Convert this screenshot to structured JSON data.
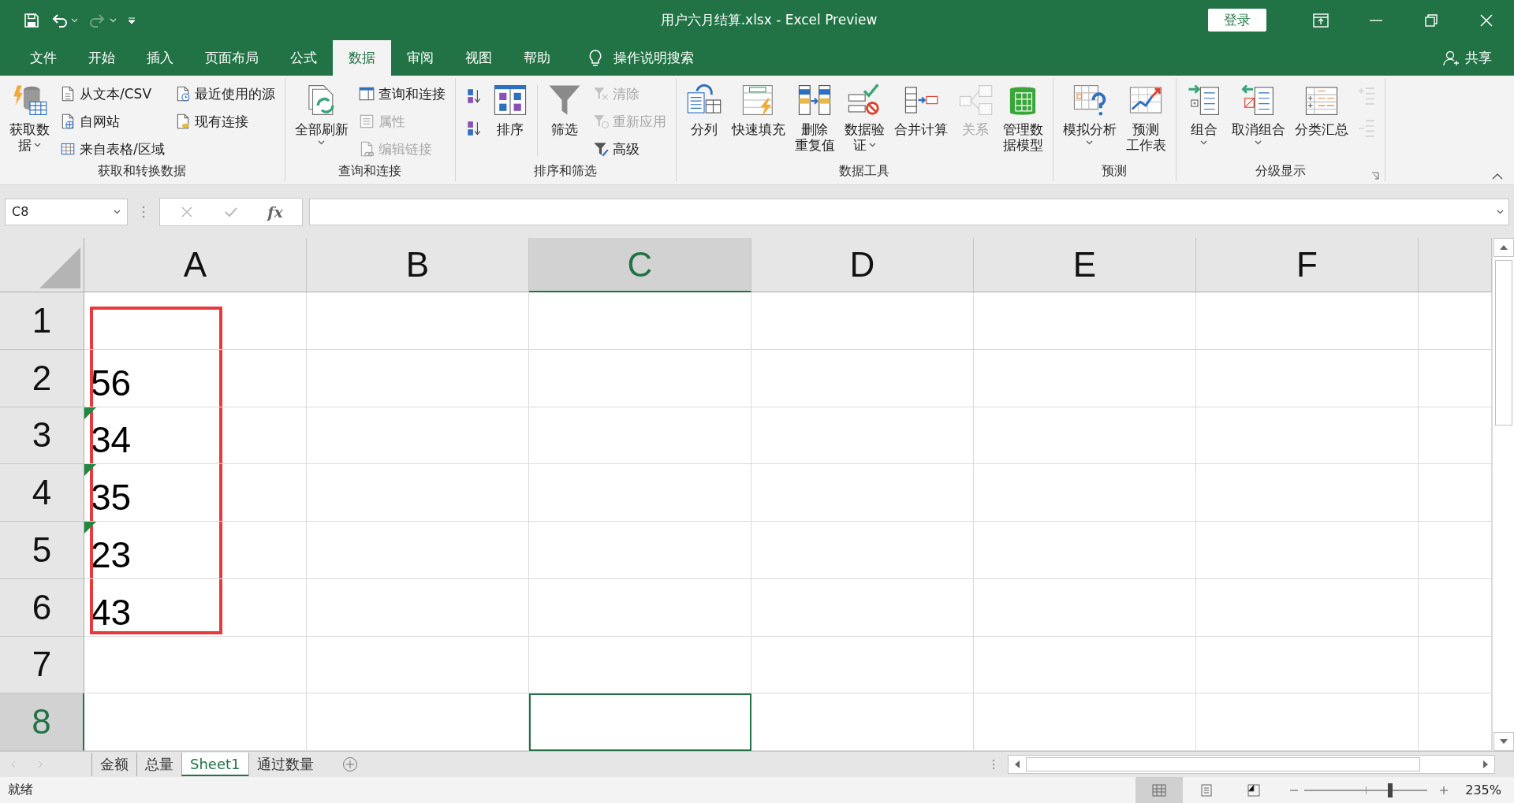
{
  "window": {
    "title": "用户六月结算.xlsx  -  Excel Preview",
    "sign_in": "登录"
  },
  "quick_access": {
    "redo_disabled": true
  },
  "tabs": [
    {
      "label": "文件",
      "selected": false
    },
    {
      "label": "开始",
      "selected": false
    },
    {
      "label": "插入",
      "selected": false
    },
    {
      "label": "页面布局",
      "selected": false
    },
    {
      "label": "公式",
      "selected": false
    },
    {
      "label": "数据",
      "selected": true
    },
    {
      "label": "审阅",
      "selected": false
    },
    {
      "label": "视图",
      "selected": false
    },
    {
      "label": "帮助",
      "selected": false
    }
  ],
  "tell_me": "操作说明搜索",
  "share": "共享",
  "ribbon_groups": [
    {
      "label": "获取和转换数据",
      "items": [
        {
          "kind": "large",
          "lines": [
            "获取数",
            "据"
          ],
          "dropdown": true,
          "disabled": false
        },
        {
          "kind": "stack",
          "entries": [
            {
              "label": "从文本/CSV",
              "disabled": false
            },
            {
              "label": "自网站",
              "disabled": false
            },
            {
              "label": "来自表格/区域",
              "disabled": false
            }
          ]
        },
        {
          "kind": "stack",
          "entries": [
            {
              "label": "最近使用的源",
              "disabled": false
            },
            {
              "label": "现有连接",
              "disabled": false
            }
          ]
        }
      ]
    },
    {
      "label": "查询和连接",
      "items": [
        {
          "kind": "large",
          "lines": [
            "全部刷新"
          ],
          "dropdown": true,
          "disabled": false
        },
        {
          "kind": "stack",
          "entries": [
            {
              "label": "查询和连接",
              "disabled": false
            },
            {
              "label": "属性",
              "disabled": true
            },
            {
              "label": "编辑链接",
              "disabled": true
            }
          ]
        }
      ]
    },
    {
      "label": "排序和筛选",
      "items": [
        {
          "kind": "icons",
          "entries": [
            {
              "disabled": false
            },
            {
              "disabled": false
            }
          ]
        },
        {
          "kind": "large",
          "lines": [
            "排序"
          ],
          "dropdown": false,
          "disabled": false
        },
        {
          "kind": "separator"
        },
        {
          "kind": "large",
          "lines": [
            "筛选"
          ],
          "dropdown": false,
          "disabled": false
        },
        {
          "kind": "stack",
          "entries": [
            {
              "label": "清除",
              "disabled": true
            },
            {
              "label": "重新应用",
              "disabled": true
            },
            {
              "label": "高级",
              "disabled": false
            }
          ]
        }
      ]
    },
    {
      "label": "数据工具",
      "items": [
        {
          "kind": "large",
          "lines": [
            "分列"
          ],
          "dropdown": false,
          "disabled": false
        },
        {
          "kind": "large",
          "lines": [
            "快速填充"
          ],
          "dropdown": false,
          "disabled": false
        },
        {
          "kind": "large",
          "lines": [
            "删除",
            "重复值"
          ],
          "dropdown": false,
          "disabled": false
        },
        {
          "kind": "large",
          "lines": [
            "数据验",
            "证"
          ],
          "dropdown": true,
          "disabled": false
        },
        {
          "kind": "large",
          "lines": [
            "合并计算"
          ],
          "dropdown": false,
          "disabled": false
        },
        {
          "kind": "large",
          "lines": [
            "关系"
          ],
          "dropdown": false,
          "disabled": true
        },
        {
          "kind": "large",
          "lines": [
            "管理数",
            "据模型"
          ],
          "dropdown": false,
          "disabled": false
        }
      ]
    },
    {
      "label": "预测",
      "items": [
        {
          "kind": "large",
          "lines": [
            "模拟分析"
          ],
          "dropdown": true,
          "disabled": false
        },
        {
          "kind": "large",
          "lines": [
            "预测",
            "工作表"
          ],
          "dropdown": false,
          "disabled": false
        }
      ]
    },
    {
      "label": "分级显示",
      "launcher": true,
      "items": [
        {
          "kind": "large",
          "lines": [
            "组合"
          ],
          "dropdown": true,
          "disabled": false
        },
        {
          "kind": "large",
          "lines": [
            "取消组合"
          ],
          "dropdown": true,
          "disabled": false
        },
        {
          "kind": "large",
          "lines": [
            "分类汇总"
          ],
          "dropdown": false,
          "disabled": false
        },
        {
          "kind": "icons",
          "entries": [
            {
              "disabled": true
            },
            {
              "disabled": true
            }
          ]
        }
      ]
    }
  ],
  "formula_bar": {
    "name_box": "C8",
    "function_label": "fx"
  },
  "grid": {
    "columns": [
      {
        "label": "A",
        "selected": false
      },
      {
        "label": "B",
        "selected": false
      },
      {
        "label": "C",
        "selected": true
      },
      {
        "label": "D",
        "selected": false
      },
      {
        "label": "E",
        "selected": false
      },
      {
        "label": "F",
        "selected": false
      }
    ],
    "rows": [
      {
        "label": "1",
        "selected": false,
        "outlined": true
      },
      {
        "label": "2",
        "selected": false,
        "outlined": true,
        "value": "56",
        "error_indicator": false
      },
      {
        "label": "3",
        "selected": false,
        "outlined": true,
        "value": "34",
        "error_indicator": true
      },
      {
        "label": "4",
        "selected": false,
        "outlined": true,
        "value": "35",
        "error_indicator": true
      },
      {
        "label": "5",
        "selected": false,
        "outlined": true,
        "value": "23",
        "error_indicator": true
      },
      {
        "label": "6",
        "selected": false,
        "outlined": true,
        "value": "43",
        "error_indicator": false
      },
      {
        "label": "7",
        "selected": false,
        "outlined": false
      },
      {
        "label": "8",
        "selected": true,
        "outlined": false
      }
    ]
  },
  "sheet_tabs": [
    {
      "label": "金额",
      "selected": false
    },
    {
      "label": "总量",
      "selected": false
    },
    {
      "label": "Sheet1",
      "selected": true
    },
    {
      "label": "通过数量",
      "selected": false
    }
  ],
  "status_bar": {
    "status": "就绪",
    "views": [
      {
        "selected": true
      },
      {
        "selected": false
      },
      {
        "selected": false
      }
    ],
    "zoom": {
      "level": 0.7,
      "reading": "235%"
    }
  }
}
